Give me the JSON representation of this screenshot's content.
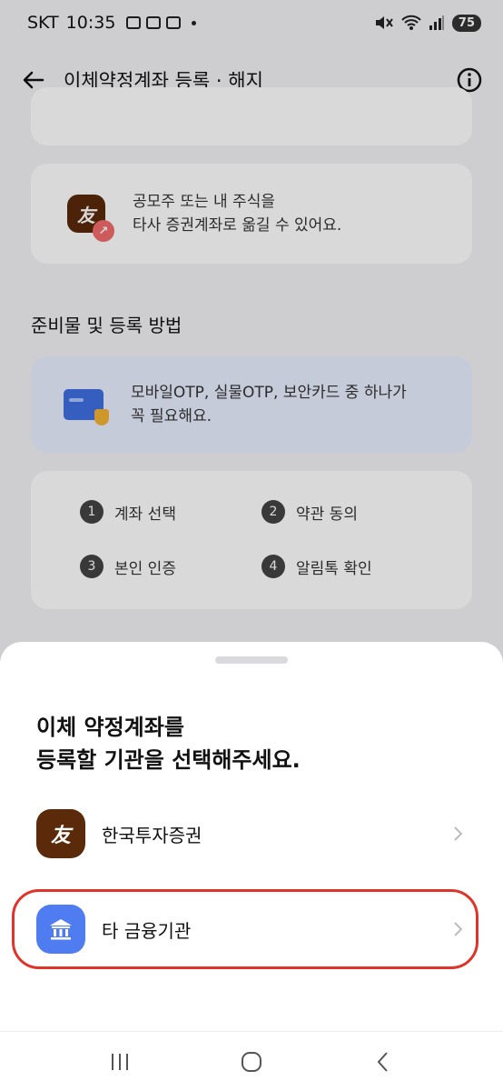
{
  "status": {
    "carrier": "SKT",
    "time": "10:35",
    "battery": "75"
  },
  "header": {
    "title": "이체약정계좌 등록 · 해지"
  },
  "background": {
    "top_card_text": "",
    "move_card": {
      "line1": "공모주 또는 내 주식을",
      "line2": "타사 증권계좌로 옮길 수 있어요."
    },
    "section_title": "준비물 및 등록 방법",
    "requirement": {
      "line1": "모바일OTP, 실물OTP, 보안카드 중 하나가",
      "line2": "꼭 필요해요."
    },
    "steps": [
      {
        "num": "1",
        "label": "계좌 선택"
      },
      {
        "num": "2",
        "label": "약관 동의"
      },
      {
        "num": "3",
        "label": "본인 인증"
      },
      {
        "num": "4",
        "label": "알림톡 확인"
      }
    ]
  },
  "sheet": {
    "title_line1": "이체 약정계좌를",
    "title_line2": "등록할 기관을 선택해주세요.",
    "options": [
      {
        "label": "한국투자증권",
        "icon": "korea-investment-logo"
      },
      {
        "label": "타 금융기관",
        "icon": "bank-icon"
      }
    ],
    "highlight_color": "#e0342a"
  },
  "logo_glyph": "友"
}
